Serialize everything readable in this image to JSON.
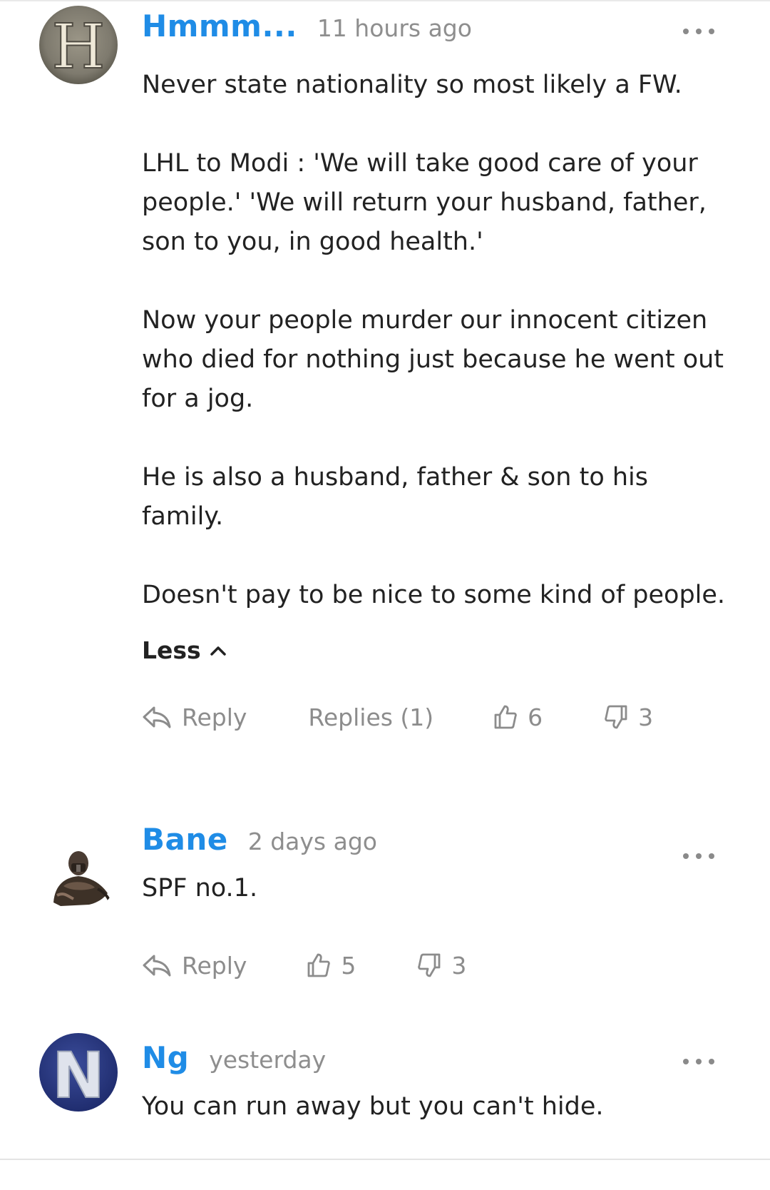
{
  "comments": [
    {
      "author": "Hmmm...",
      "time": "11 hours ago",
      "avatar_letter": "H",
      "paragraphs": [
        "Never state nationality so most likely a FW.",
        "LHL to Modi : 'We will take good care of your people.' 'We will return your husband, father, son to you, in good health.'",
        "Now your people murder our innocent citizen who died for nothing just because he went out for a jog.",
        "He is also a husband, father & son to his family.",
        "Doesn't pay to be nice to some kind of people."
      ],
      "less_label": "Less",
      "reply_label": "Reply",
      "replies_label": "Replies (1)",
      "likes": "6",
      "dislikes": "3"
    },
    {
      "author": "Bane",
      "time": "2 days ago",
      "paragraphs": [
        "SPF no.1."
      ],
      "reply_label": "Reply",
      "likes": "5",
      "dislikes": "3"
    },
    {
      "author": "Ng",
      "time": "yesterday",
      "avatar_letter": "N",
      "paragraphs": [
        "You can run away but you can't hide."
      ]
    }
  ],
  "icons": {
    "more": "more-horizontal-icon",
    "reply": "reply-arrow-icon",
    "like": "thumbs-up-icon",
    "dislike": "thumbs-down-icon",
    "less": "chevron-up-icon"
  },
  "colors": {
    "author": "#1f8ce6",
    "muted": "#8e8e8e",
    "text": "#222222"
  }
}
